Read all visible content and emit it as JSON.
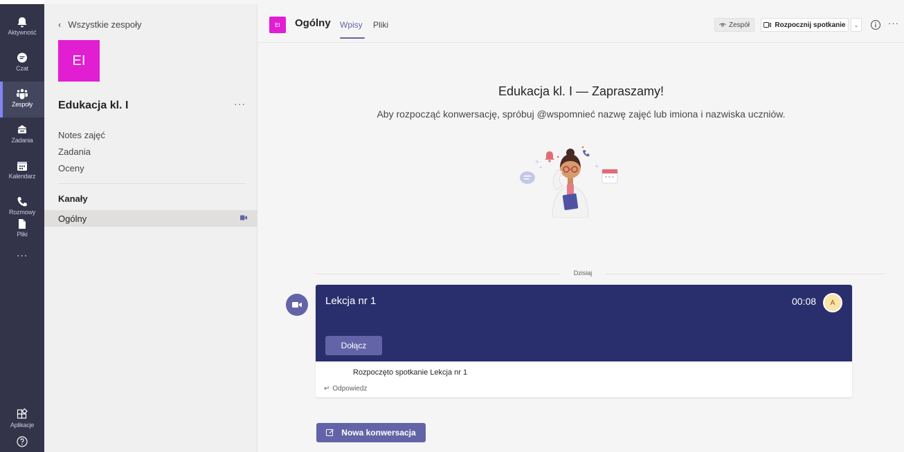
{
  "rail": {
    "items": [
      {
        "label": "Aktywność",
        "icon": "bell-icon"
      },
      {
        "label": "Czat",
        "icon": "chat-icon"
      },
      {
        "label": "Zespoły",
        "icon": "teams-icon"
      },
      {
        "label": "Zadania",
        "icon": "assignments-icon"
      },
      {
        "label": "Kalendarz",
        "icon": "calendar-icon"
      },
      {
        "label": "Rozmowy",
        "icon": "phone-icon"
      },
      {
        "label": "Pliki",
        "icon": "file-icon"
      }
    ],
    "more": "...",
    "apps_label": "Aplikacje",
    "help_icon": "help-icon",
    "active": "Zespoły"
  },
  "team_pane": {
    "back_label": "Wszystkie zespoły",
    "avatar_initials": "EI",
    "avatar_color": "#e11ed2",
    "team_name": "Edukacja kl. I",
    "more": "···",
    "links": [
      "Notes zajęć",
      "Zadania",
      "Oceny"
    ],
    "channels_header": "Kanały",
    "channels": [
      {
        "name": "Ogólny",
        "icon": "video-camera-icon"
      }
    ]
  },
  "header": {
    "avatar_initials": "EI",
    "channel_name": "Ogólny",
    "tabs": [
      "Wpisy",
      "Pliki"
    ],
    "active_tab": "Wpisy",
    "team_button": "Zespół",
    "meet_button": "Rozpocznij spotkanie",
    "info_icon": "info-icon",
    "more": "···"
  },
  "welcome": {
    "title": "Edukacja kl. I — Zapraszamy!",
    "subtitle": "Aby rozpocząć konwersację, spróbuj @wspomnieć nazwę zajęć lub imiona i nazwiska uczniów."
  },
  "feed": {
    "date_label": "Dzisiaj",
    "meeting": {
      "title": "Lekcja nr 1",
      "duration": "00:08",
      "participant_initial": "A",
      "join_label": "Dołącz",
      "message": "Rozpoczęto spotkanie Lekcja nr 1",
      "reply_label": "Odpowiedz",
      "card_color": "#292f6d"
    }
  },
  "new_conversation": "Nowa konwersacja",
  "colors": {
    "accent": "#6264a7",
    "rail": "#33344a"
  }
}
